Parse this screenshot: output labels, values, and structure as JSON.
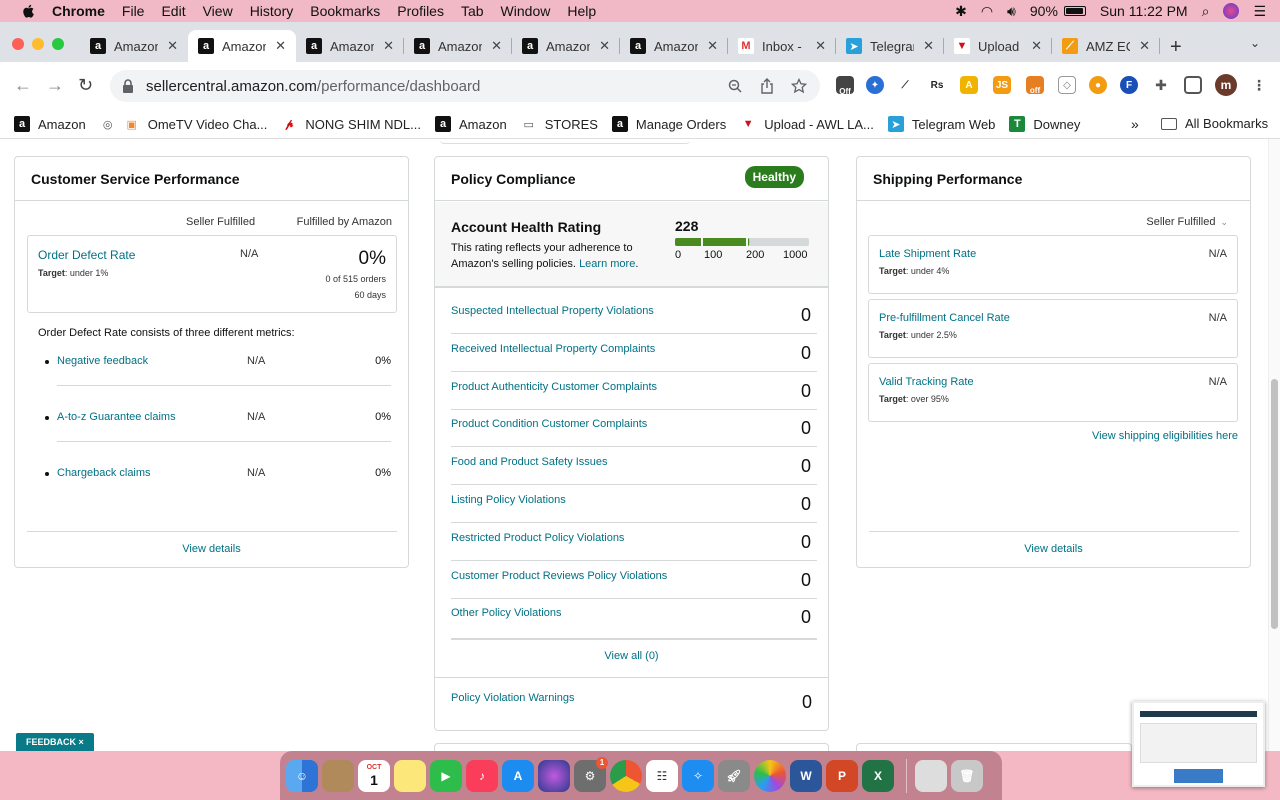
{
  "menubar": {
    "items": [
      "Chrome",
      "File",
      "Edit",
      "View",
      "History",
      "Bookmarks",
      "Profiles",
      "Tab",
      "Window",
      "Help"
    ],
    "battery": "90%",
    "clock": "Sun 11:22 PM"
  },
  "tabs": [
    {
      "label": "Amazon"
    },
    {
      "label": "Amazon"
    },
    {
      "label": "Amazon"
    },
    {
      "label": "Amazon"
    },
    {
      "label": "Amazon"
    },
    {
      "label": "Amazon"
    },
    {
      "label": "Inbox -"
    },
    {
      "label": "Telegram"
    },
    {
      "label": "Upload"
    },
    {
      "label": "AMZ EC"
    }
  ],
  "omnibox": {
    "host": "sellercentral.amazon.com",
    "path": "/performance/dashboard"
  },
  "extensions": {
    "off1": "Off",
    "rs": "Rs",
    "js": "JS",
    "off2": "off",
    "f": "F",
    "profile": "m"
  },
  "bookmarks": [
    {
      "label": "Amazon"
    },
    {
      "label": "OmeTV Video Cha..."
    },
    {
      "label": "NONG SHIM NDL..."
    },
    {
      "label": "Amazon"
    },
    {
      "label": "STORES"
    },
    {
      "label": "Manage Orders"
    },
    {
      "label": "Upload - AWL LA..."
    },
    {
      "label": "Telegram Web"
    },
    {
      "label": "Downey"
    }
  ],
  "bookmarks_more": "»",
  "all_bookmarks": "All Bookmarks",
  "customer_service": {
    "title": "Customer Service Performance",
    "col_seller": "Seller Fulfilled",
    "col_fba": "Fulfilled by Amazon",
    "odr": {
      "label": "Order Defect Rate",
      "target_label": "Target",
      "target_value": ": under 1%",
      "seller": "N/A",
      "fba": "0%",
      "orders": "0 of 515 orders",
      "days": "60 days"
    },
    "consists_text": "Order Defect Rate consists of three different metrics:",
    "metrics": [
      {
        "label": "Negative feedback",
        "seller": "N/A",
        "fba": "0%"
      },
      {
        "label": "A-to-z Guarantee claims",
        "seller": "N/A",
        "fba": "0%"
      },
      {
        "label": "Chargeback claims",
        "seller": "N/A",
        "fba": "0%"
      }
    ],
    "view_details": "View details"
  },
  "policy": {
    "title": "Policy Compliance",
    "badge": "Healthy",
    "ahr_title": "Account Health Rating",
    "ahr_desc": "This rating reflects your adherence to Amazon's selling policies.",
    "learn_more": "Learn more",
    "ahr_end": ".",
    "score": "228",
    "score_value": 228,
    "scale": [
      "0",
      "100",
      "200",
      "1000"
    ],
    "rows": [
      {
        "label": "Suspected Intellectual Property Violations",
        "count": "0"
      },
      {
        "label": "Received Intellectual Property Complaints",
        "count": "0"
      },
      {
        "label": "Product Authenticity Customer Complaints",
        "count": "0"
      },
      {
        "label": "Product Condition Customer Complaints",
        "count": "0"
      },
      {
        "label": "Food and Product Safety Issues",
        "count": "0"
      },
      {
        "label": "Listing Policy Violations",
        "count": "0"
      },
      {
        "label": "Restricted Product Policy Violations",
        "count": "0"
      },
      {
        "label": "Customer Product Reviews Policy Violations",
        "count": "0"
      },
      {
        "label": "Other Policy Violations",
        "count": "0"
      }
    ],
    "view_all": "View all (0)",
    "warnings_label": "Policy Violation Warnings",
    "warnings_count": "0"
  },
  "shipping": {
    "title": "Shipping Performance",
    "filter": "Seller Fulfilled",
    "metrics": [
      {
        "label": "Late Shipment Rate",
        "target_label": "Target",
        "target_value": ": under 4%",
        "value": "N/A"
      },
      {
        "label": "Pre-fulfillment Cancel Rate",
        "target_label": "Target",
        "target_value": ": under 2.5%",
        "value": "N/A"
      },
      {
        "label": "Valid Tracking Rate",
        "target_label": "Target",
        "target_value": ": over 95%",
        "value": "N/A"
      }
    ],
    "eligibilities": "View shipping eligibilities here",
    "view_details": "View details"
  },
  "feedback": "FEEDBACK",
  "feedback_x": "×",
  "dock": {
    "calendar_month": "OCT",
    "calendar_day": "1",
    "badge": "1"
  },
  "colors": {
    "link": "#007185",
    "healthy": "#2a7c1c",
    "menubar": "#f0b9c5"
  }
}
